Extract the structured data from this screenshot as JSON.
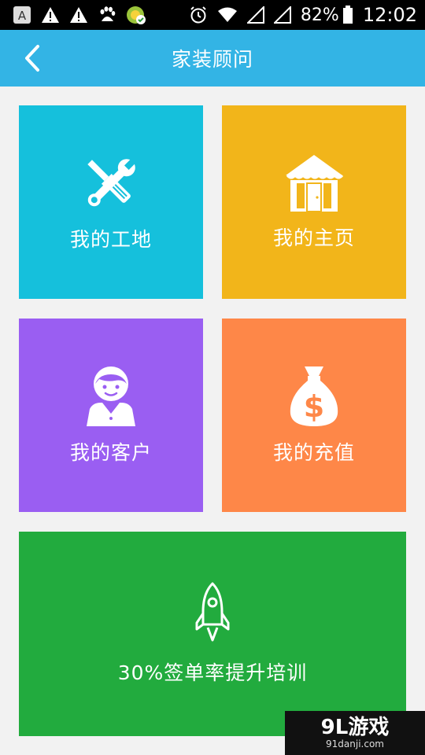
{
  "status_bar": {
    "battery_percent": "82%",
    "time": "12:02",
    "icons": [
      "a-badge-icon",
      "warning-icon",
      "warning-icon",
      "baidu-icon",
      "app-badge-icon",
      "alarm-icon",
      "wifi-icon",
      "signal-icon",
      "signal-icon",
      "battery-icon"
    ]
  },
  "header": {
    "title": "家装顾问",
    "back_icon": "chevron-left-icon"
  },
  "tiles": [
    {
      "label": "我的工地",
      "icon": "tools-icon",
      "color": "#15c0dc"
    },
    {
      "label": "我的主页",
      "icon": "house-icon",
      "color": "#f2b51a"
    },
    {
      "label": "我的客户",
      "icon": "person-icon",
      "color": "#9a5ef2"
    },
    {
      "label": "我的充值",
      "icon": "money-bag-icon",
      "color": "#fe8748"
    },
    {
      "label": "30%签单率提升培训",
      "icon": "rocket-icon",
      "color": "#22ab3e"
    }
  ],
  "watermark": {
    "logo": "9L游戏",
    "site": "91danji.com"
  },
  "colors": {
    "header": "#33b4e5",
    "background": "#f2f2f2"
  }
}
